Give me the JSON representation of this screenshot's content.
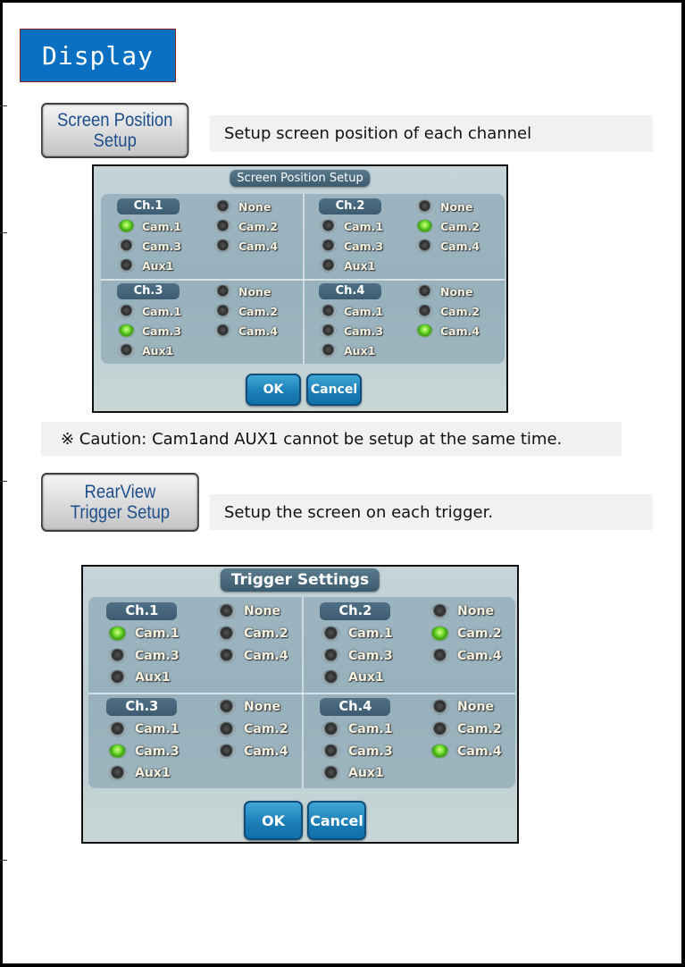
{
  "section_title": "Display",
  "screen_position": {
    "button_label": "Screen Position\nSetup",
    "description": "Setup screen position of each channel",
    "dialog": {
      "title": "Screen Position Setup",
      "ok_label": "OK",
      "cancel_label": "Cancel",
      "channels": [
        {
          "label": "Ch.1",
          "selected": "Cam.1"
        },
        {
          "label": "Ch.2",
          "selected": "Cam.2"
        },
        {
          "label": "Ch.3",
          "selected": "Cam.3"
        },
        {
          "label": "Ch.4",
          "selected": "Cam.4"
        }
      ]
    }
  },
  "caution": "※ Caution: Cam1and AUX1 cannot be setup at the same time.",
  "rearview_trigger": {
    "button_label": "RearView\nTrigger Setup",
    "description": "Setup the screen on each trigger.",
    "dialog": {
      "title": "Trigger Settings",
      "ok_label": "OK",
      "cancel_label": "Cancel",
      "channels": [
        {
          "label": "Ch.1",
          "selected": "Cam.1"
        },
        {
          "label": "Ch.2",
          "selected": "Cam.2"
        },
        {
          "label": "Ch.3",
          "selected": "Cam.3"
        },
        {
          "label": "Ch.4",
          "selected": "Cam.4"
        }
      ]
    }
  },
  "options": [
    "None",
    "Cam.1",
    "Cam.2",
    "Cam.3",
    "Cam.4",
    "Aux1"
  ],
  "colors": {
    "title_bg": "#0b70c2",
    "button_text": "#1d4f8c",
    "radio_selected": "#6bd82a",
    "dialog_button": "#1a7cb5"
  }
}
